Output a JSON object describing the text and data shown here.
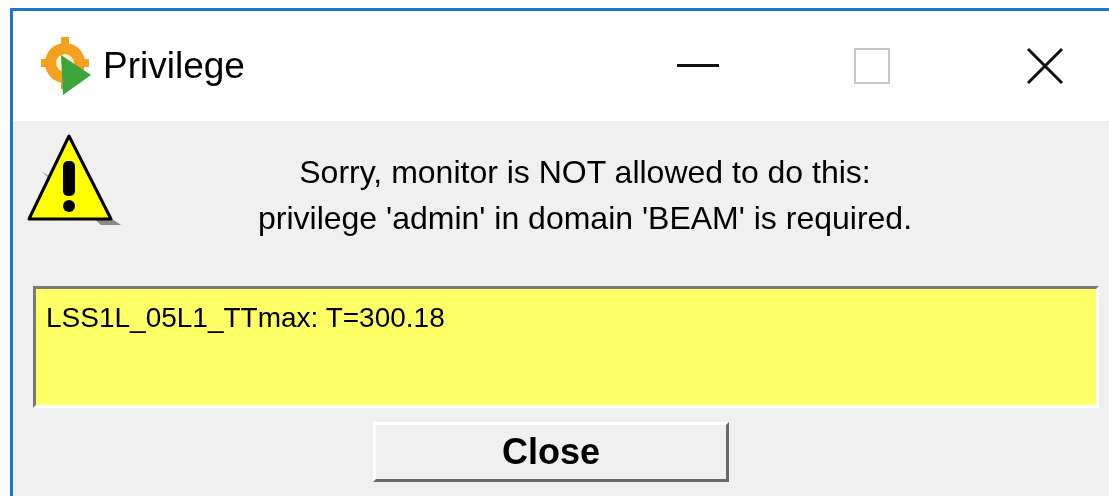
{
  "window": {
    "title": "Privilege"
  },
  "message": [
    "Sorry, monitor is NOT allowed to do this:",
    "privilege 'admin' in domain 'BEAM' is required."
  ],
  "details": "LSS1L_05L1_TTmax: T=300.18",
  "buttons": [
    "Close"
  ]
}
